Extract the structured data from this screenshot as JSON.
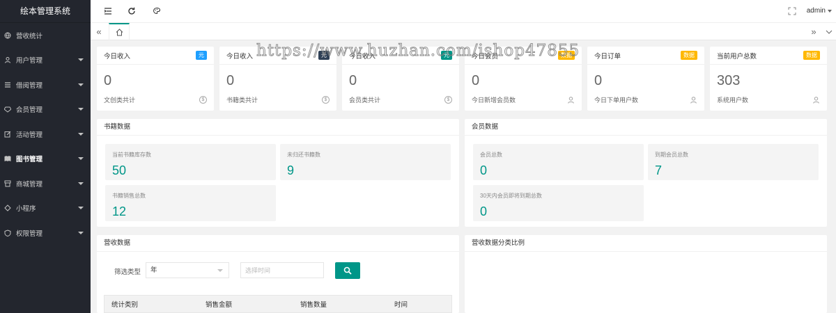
{
  "app": {
    "title": "绘本管理系统",
    "user": "admin"
  },
  "sidebar": {
    "items": [
      {
        "label": "营收统计",
        "icon": "globe-icon",
        "has_submenu": false
      },
      {
        "label": "用户管理",
        "icon": "user-icon",
        "has_submenu": true
      },
      {
        "label": "借阅管理",
        "icon": "bars-icon",
        "has_submenu": true
      },
      {
        "label": "会员管理",
        "icon": "diamond-icon",
        "has_submenu": true
      },
      {
        "label": "活动管理",
        "icon": "edit-icon",
        "has_submenu": true
      },
      {
        "label": "图书管理",
        "icon": "book-icon",
        "has_submenu": true
      },
      {
        "label": "商城管理",
        "icon": "shop-icon",
        "has_submenu": true
      },
      {
        "label": "小程序",
        "icon": "app-icon",
        "has_submenu": true
      },
      {
        "label": "权限管理",
        "icon": "shield-icon",
        "has_submenu": true
      }
    ]
  },
  "tabs": {
    "prev": "«",
    "next": "»"
  },
  "stats": [
    {
      "title": "今日收入",
      "badge": "元",
      "badge_color": "#1e9fff",
      "value": "0",
      "footer": "文创类共计",
      "footer_icon": "$"
    },
    {
      "title": "今日收入",
      "badge": "元",
      "badge_color": "#2f4056",
      "value": "0",
      "footer": "书籍类共计",
      "footer_icon": "$"
    },
    {
      "title": "今日收入",
      "badge": "元",
      "badge_color": "#009688",
      "value": "0",
      "footer": "会员类共计",
      "footer_icon": "$"
    },
    {
      "title": "今日会员",
      "badge": "数据",
      "badge_color": "#ffb800",
      "value": "0",
      "footer": "今日新增会员数",
      "footer_icon": "user"
    },
    {
      "title": "今日订单",
      "badge": "数据",
      "badge_color": "#ffb800",
      "value": "0",
      "footer": "今日下单用户数",
      "footer_icon": "user"
    },
    {
      "title": "当前用户总数",
      "badge": "数据",
      "badge_color": "#ffb800",
      "value": "303",
      "footer": "系统用户数",
      "footer_icon": "user"
    }
  ],
  "books_panel": {
    "title": "书籍数据",
    "tiles": [
      {
        "label": "当前书籍库存数",
        "value": "50"
      },
      {
        "label": "未归还书籍数",
        "value": "9"
      },
      {
        "label": "书籍销售总数",
        "value": "12"
      }
    ]
  },
  "members_panel": {
    "title": "会员数据",
    "tiles": [
      {
        "label": "会员总数",
        "value": "0"
      },
      {
        "label": "到期会员总数",
        "value": "7"
      },
      {
        "label": "30天内会员即将到期总数",
        "value": "0"
      }
    ]
  },
  "revenue_panel": {
    "title": "营收数据",
    "filter_label": "筛选类型",
    "filter_value": "年",
    "date_placeholder": "选择时间",
    "columns": [
      "统计类别",
      "销售金额",
      "销售数量",
      "时间"
    ]
  },
  "ratio_panel": {
    "title": "营收数据分类比例"
  },
  "watermark": "https://www.huzhan.com/ishop47855",
  "colors": {
    "sidebar_bg": "#23262e",
    "accent": "#009688"
  }
}
